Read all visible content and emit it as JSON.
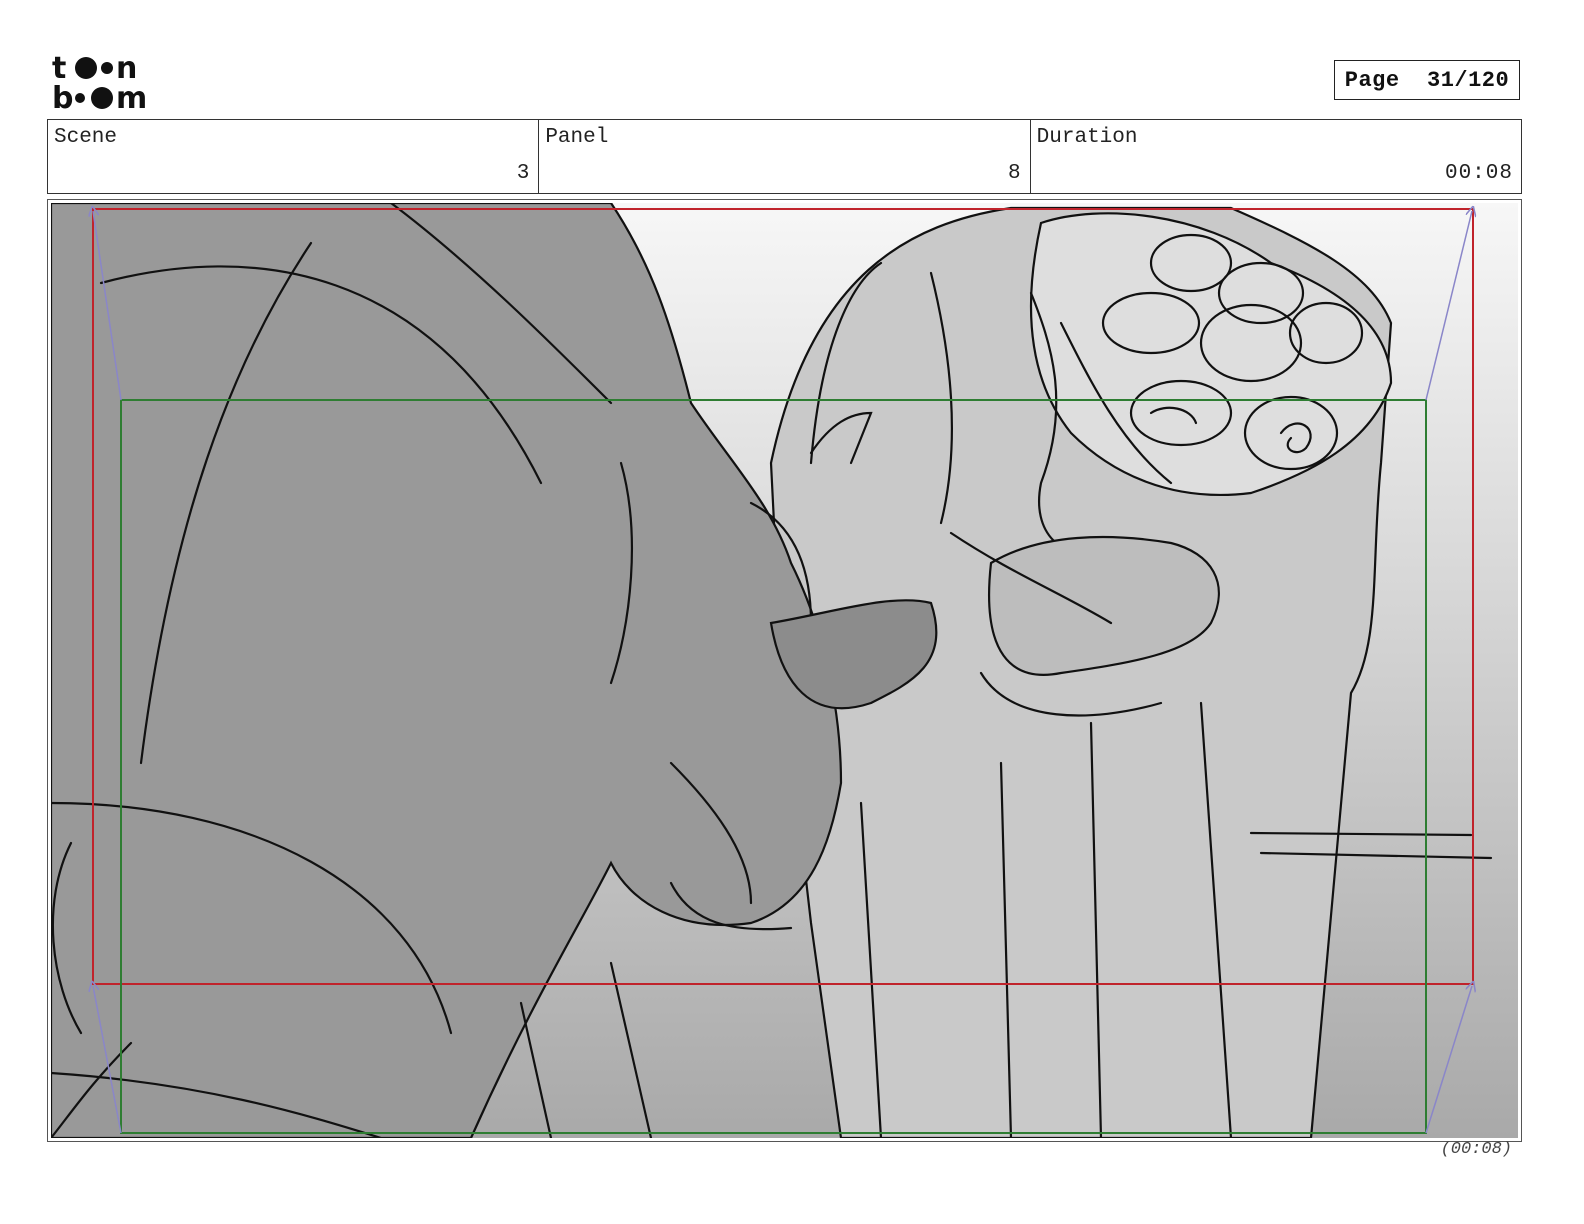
{
  "logo": {
    "line1": "toon",
    "line2": "boom"
  },
  "page": {
    "label": "Page",
    "number": "31/120"
  },
  "header": {
    "scene": {
      "label": "Scene",
      "value": "3"
    },
    "panel": {
      "label": "Panel",
      "value": "8"
    },
    "duration": {
      "label": "Duration",
      "value": "00:08"
    }
  },
  "footer": {
    "duration": "(00:08)"
  },
  "colors": {
    "safe_frame": "#c0232b",
    "action_frame": "#2e7d32",
    "camera_arrows": "#8a86c9"
  },
  "icons": [
    "toonboom-logo"
  ]
}
